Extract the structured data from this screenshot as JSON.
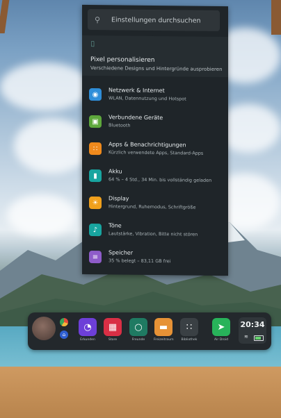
{
  "search": {
    "placeholder": "Einstellungen durchsuchen"
  },
  "promo": {
    "title": "Pixel personalisieren",
    "subtitle": "Verschiedene Designs und Hintergründe ausprobieren"
  },
  "settings": [
    {
      "title": "Netzwerk & Internet",
      "subtitle": "WLAN, Datennutzung und Hotspot",
      "color": "#2f8ed9",
      "icon": "wifi-icon",
      "glyph": "◉"
    },
    {
      "title": "Verbundene Geräte",
      "subtitle": "Bluetooth",
      "color": "#5ea83c",
      "icon": "devices-icon",
      "glyph": "▣"
    },
    {
      "title": "Apps & Benachrichtigungen",
      "subtitle": "Kürzlich verwendete Apps, Standard-Apps",
      "color": "#f08a1c",
      "icon": "apps-grid-icon",
      "glyph": "∷"
    },
    {
      "title": "Akku",
      "subtitle": "64 % – 4 Std., 34 Min. bis vollständig geladen",
      "color": "#18a5a0",
      "icon": "battery-icon",
      "glyph": "▮"
    },
    {
      "title": "Display",
      "subtitle": "Hintergrund, Ruhemodus, Schriftgröße",
      "color": "#f0a01c",
      "icon": "display-icon",
      "glyph": "☀"
    },
    {
      "title": "Töne",
      "subtitle": "Lautstärke, Vibration, Bitte nicht stören",
      "color": "#18a5a0",
      "icon": "sound-icon",
      "glyph": "♪"
    },
    {
      "title": "Speicher",
      "subtitle": "35 % belegt – 83,11 GB frei",
      "color": "#8e5cc9",
      "icon": "storage-icon",
      "glyph": "≡"
    }
  ],
  "dock": {
    "apps": [
      {
        "label": "Erkunden",
        "color": "#6d3fd8",
        "icon": "compass-icon",
        "glyph": "◔"
      },
      {
        "label": "Store",
        "color": "#d92f45",
        "icon": "store-icon",
        "glyph": "▦"
      },
      {
        "label": "Freunde",
        "color": "#1f7a62",
        "icon": "friends-icon",
        "glyph": "○"
      },
      {
        "label": "Freizeitraum",
        "color": "#e69236",
        "icon": "folder-icon",
        "glyph": "▬"
      },
      {
        "label": "Bibliothek",
        "color": "#3a4044",
        "icon": "library-grid-icon",
        "glyph": "∷"
      },
      {
        "label": "Air Droid",
        "color": "#28b35a",
        "icon": "airdroid-icon",
        "glyph": "➤"
      }
    ],
    "time": "20:34"
  }
}
